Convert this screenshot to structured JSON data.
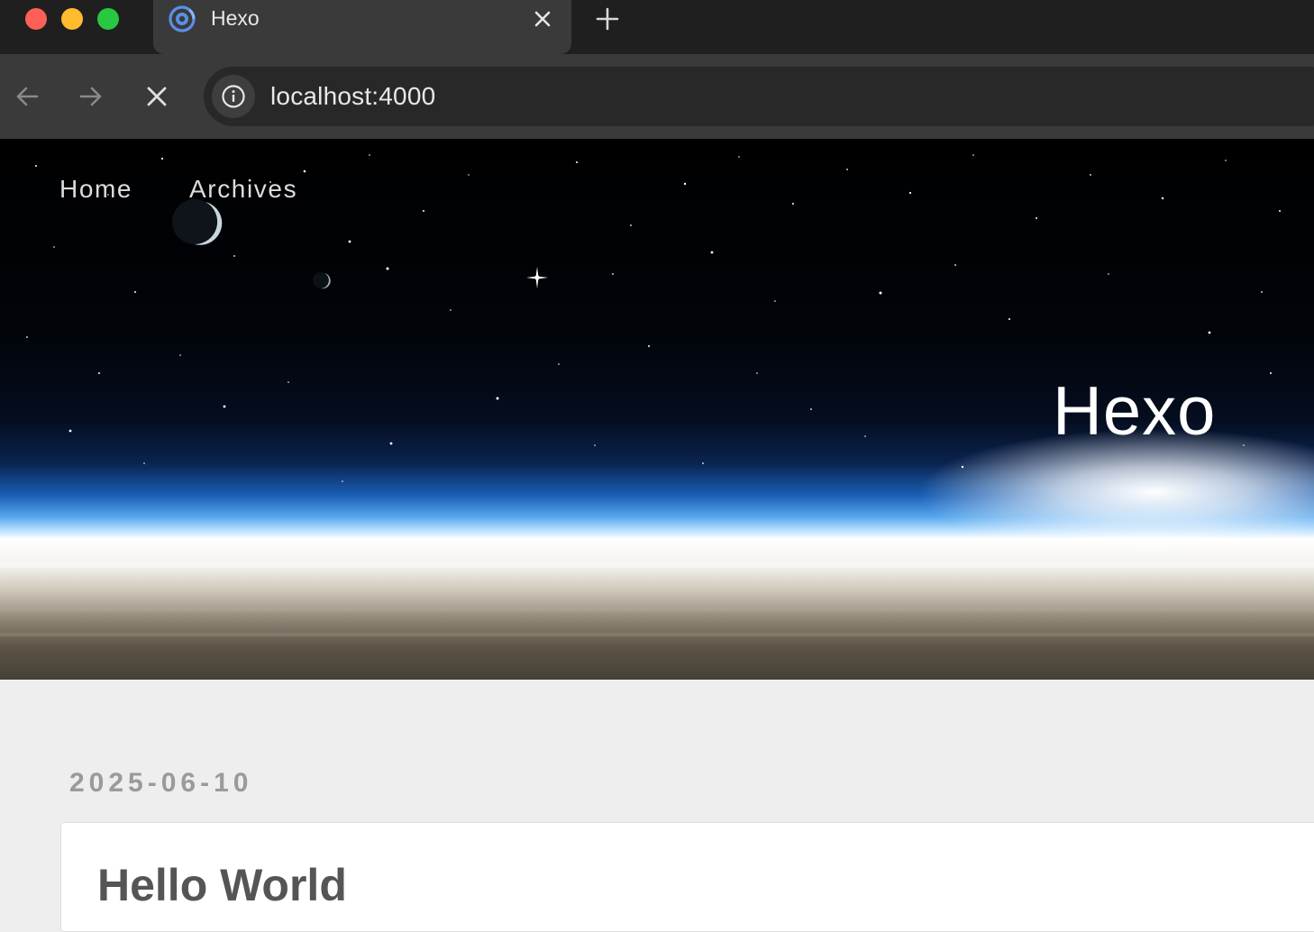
{
  "browser": {
    "tab": {
      "title": "Hexo",
      "icon": "browser-logo-icon"
    },
    "new_tab_icon": "plus-icon",
    "nav": {
      "back_icon": "arrow-left-icon",
      "forward_icon": "arrow-right-icon",
      "stop_icon": "close-icon"
    },
    "address": {
      "url": "localhost:4000",
      "info_icon": "info-icon"
    },
    "traffic_lights": {
      "close": "#fe5f57",
      "minimize": "#febc2e",
      "maximize": "#28c840"
    }
  },
  "site": {
    "title": "Hexo",
    "nav": [
      {
        "label": "Home"
      },
      {
        "label": "Archives"
      }
    ]
  },
  "post": {
    "date": "2025-06-10",
    "title": "Hello World"
  }
}
